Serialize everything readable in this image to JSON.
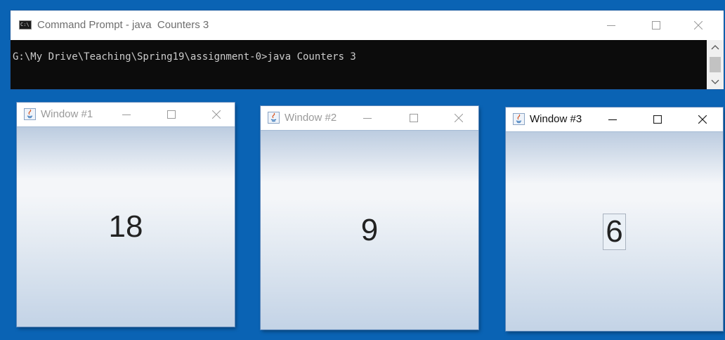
{
  "cmd": {
    "title": "Command Prompt - java  Counters 3",
    "icon": "C:\\",
    "output": "G:\\My Drive\\Teaching\\Spring19\\assignment-0>java Counters 3"
  },
  "windows": [
    {
      "title": "Window #1",
      "count": "18"
    },
    {
      "title": "Window #2",
      "count": "9"
    },
    {
      "title": "Window #3",
      "count": "6"
    }
  ],
  "colors": {
    "desktop": "#0a63b4",
    "console_bg": "#0c0c0c",
    "console_text": "#cccccc"
  }
}
